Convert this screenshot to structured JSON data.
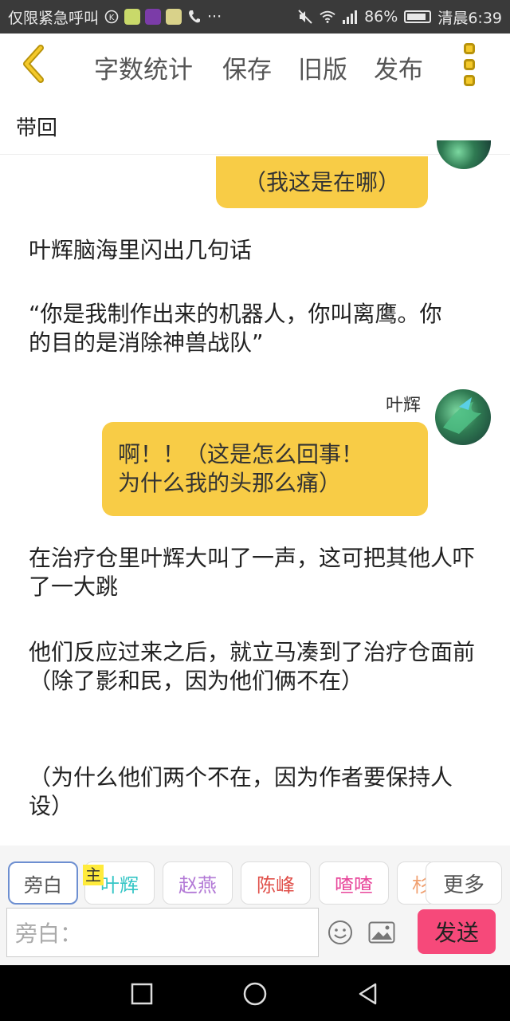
{
  "status_bar": {
    "left_text": "仅限紧急呼叫",
    "left_icons": [
      "k-circle-icon",
      "app-icon-1",
      "app-icon-2",
      "app-icon-3",
      "phone-icon"
    ],
    "ellipsis": "···",
    "right_icons": [
      "mute-icon",
      "wifi-icon",
      "signal-icon"
    ],
    "battery": "86%",
    "battery_level": 0.86,
    "time": "清晨6:39"
  },
  "header": {
    "back_icon": "chevron-left-icon",
    "word_count": "字数统计",
    "save": "保存",
    "old_version": "旧版",
    "publish": "发布",
    "more_icon": "more-vertical-icon",
    "subtitle": "带回",
    "accent_color": "#f4c92b"
  },
  "chat": {
    "bubble_top": "（我这是在哪）",
    "narration_1": "叶辉脑海里闪出几句话",
    "narration_2": "“你是我制作出来的机器人，你叫离鹰。你的目的是消除神兽战队”",
    "speaker_name": "叶辉",
    "bubble_main_line1": "啊！！（这是怎么回事！",
    "bubble_main_line2": "为什么我的头那么痛）",
    "narration_3": "在治疗仓里叶辉大叫了一声，这可把其他人吓了一大跳",
    "narration_4": "他们反应过来之后，就立马凑到了治疗仓面前（除了影和民，因为他们俩不在）",
    "narration_5": "（为什么他们两个不在，因为作者要保持人设）",
    "bubble_color": "#f8cc46"
  },
  "composer": {
    "characters": [
      {
        "label": "旁白",
        "color": "#555555"
      },
      {
        "label": "叶辉",
        "color": "#35c6c6"
      },
      {
        "label": "赵燕",
        "color": "#b37ad6"
      },
      {
        "label": "陈峰",
        "color": "#e0504a"
      },
      {
        "label": "喳喳",
        "color": "#e8479b"
      },
      {
        "label": "杉",
        "color": "#f0a070"
      }
    ],
    "main_badge": "主",
    "more": "更多",
    "input_placeholder": "旁白：",
    "emoji_icon": "smiley-icon",
    "image_icon": "image-icon",
    "send": "发送",
    "send_color": "#f6497a"
  },
  "nav_bar": {
    "recents_icon": "square-icon",
    "home_icon": "circle-icon",
    "back_icon": "triangle-back-icon"
  }
}
